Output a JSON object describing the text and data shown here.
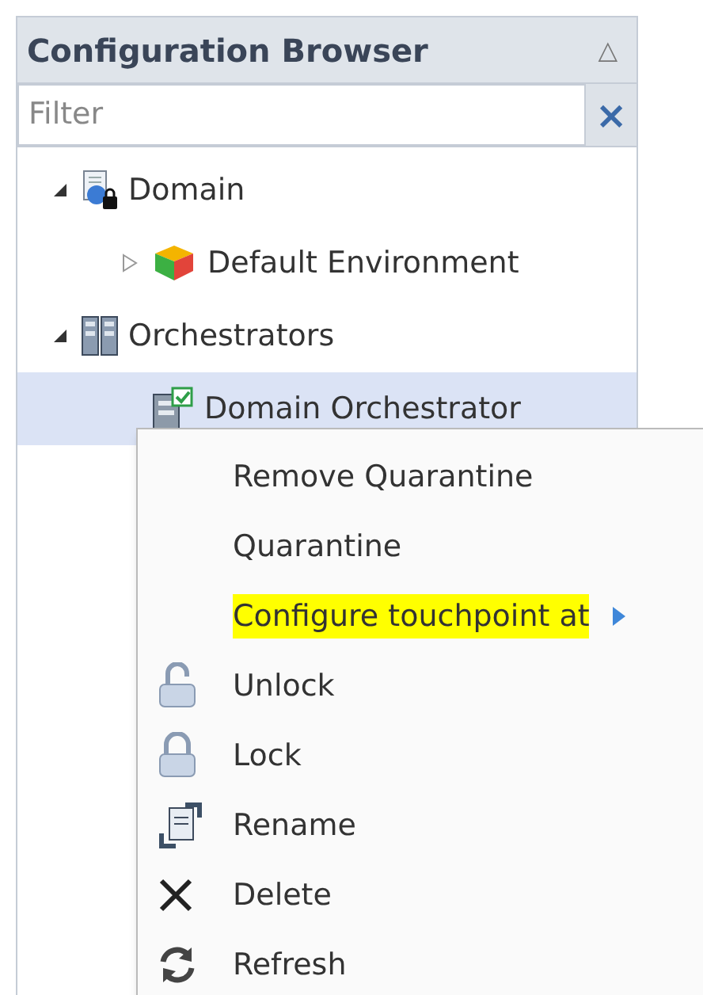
{
  "panel": {
    "title": "Configuration Browser",
    "collapse_glyph": "△"
  },
  "filter": {
    "placeholder": "Filter",
    "clear": "×"
  },
  "tree": [
    {
      "label": "Domain",
      "kind": "domain",
      "expanded": true,
      "selected": false,
      "children": [
        {
          "label": "Default Environment",
          "kind": "environment",
          "expanded": false,
          "selected": false
        }
      ]
    },
    {
      "label": "Orchestrators",
      "kind": "servers",
      "expanded": true,
      "selected": false,
      "children": [
        {
          "label": "Domain Orchestrator",
          "kind": "orchestrator",
          "selected": true
        }
      ]
    }
  ],
  "context_menu": [
    {
      "label": "Remove Quarantine",
      "kind": "plain",
      "highlighted": false,
      "submenu": false
    },
    {
      "label": "Quarantine",
      "kind": "plain",
      "highlighted": false,
      "submenu": false
    },
    {
      "label": "Configure touchpoint at",
      "kind": "plain",
      "highlighted": true,
      "submenu": true
    },
    {
      "label": "Unlock",
      "kind": "unlock",
      "highlighted": false,
      "submenu": false
    },
    {
      "label": "Lock",
      "kind": "lock",
      "highlighted": false,
      "submenu": false
    },
    {
      "label": "Rename",
      "kind": "rename",
      "highlighted": false,
      "submenu": false
    },
    {
      "label": "Delete",
      "kind": "delete",
      "highlighted": false,
      "submenu": false
    },
    {
      "label": "Refresh",
      "kind": "refresh",
      "highlighted": false,
      "submenu": false
    }
  ]
}
